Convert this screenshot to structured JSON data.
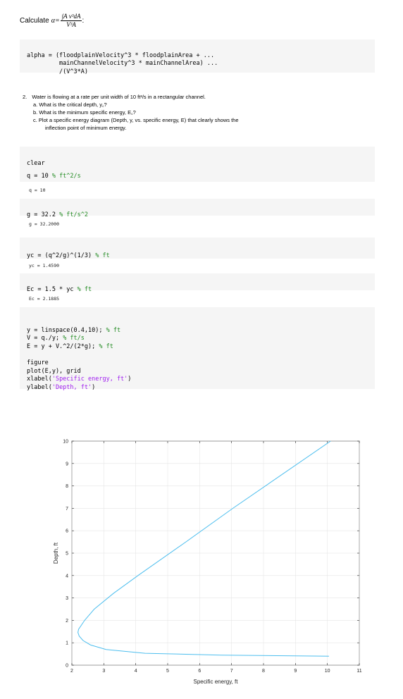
{
  "calculate": {
    "prefix": "Calculate",
    "alpha": "α=",
    "numerator": "∫A v³dA",
    "denominator": "V³A",
    "suffix": ":"
  },
  "code_alpha": [
    "alpha = (floodplainVelocity^3 * floodplainArea + ...",
    "         mainChannelVelocity^3 * mainChannelArea) ...",
    "         /(V^3*A)"
  ],
  "problem": {
    "number": "2.",
    "text": "Water is flowing at a rate per unit width of 10 ft²/s in a rectangular channel.",
    "a": "a.   What is the critical depth, y꜀?",
    "b": "b.   What is the minimum specific energy, E꜀?",
    "c1": "c.   Plot a specific energy diagram (Depth, y, vs. specific energy, E) that clearly shows the",
    "c2": "inflection point of minimum energy."
  },
  "code": {
    "clear": "clear",
    "q_code": "q = 10 ",
    "q_comment": "% ft^2/s",
    "q_out": "q = 10",
    "g_code": "g = 32.2 ",
    "g_comment": "% ft/s^2",
    "g_out": "g = 32.2000",
    "yc_code": "yc = (q^2/g)^(1/3) ",
    "yc_comment": "% ft",
    "yc_out": "yc = 1.4590",
    "ec_code": "Ec = 1.5 * yc ",
    "ec_comment": "% ft",
    "ec_out": "Ec = 2.1885",
    "y_code": "y = linspace(0.4,10); ",
    "y_comment": "% ft",
    "v_code": "V = q./y; ",
    "v_comment": "% ft/s",
    "e_code": "E = y + V.^2/(2*g); ",
    "e_comment": "% ft",
    "figure": "figure",
    "plot": "plot(E,y), grid",
    "xlabel_pre": "xlabel(",
    "xlabel_str": "'Specific energy, ft'",
    "ylabel_pre": "ylabel(",
    "ylabel_str": "'Depth, ft'",
    "close_paren": ")"
  },
  "chart_data": {
    "type": "line",
    "xlabel": "Specific energy, ft",
    "ylabel": "Depth, ft",
    "xlim": [
      2,
      11
    ],
    "ylim": [
      0,
      10
    ],
    "xticks": [
      2,
      3,
      4,
      5,
      6,
      7,
      8,
      9,
      10,
      11
    ],
    "yticks": [
      0,
      1,
      2,
      3,
      4,
      5,
      6,
      7,
      8,
      9,
      10
    ],
    "grid": true,
    "line_color": "#4dbeee",
    "function": "E = y + q^2/(2*g*y^2), q = 10, g = 32.2",
    "series": [
      {
        "x": [
          10.1,
          7.04,
          5.57,
          4.07,
          3.3,
          2.7,
          2.4,
          2.21,
          2.19,
          2.23,
          2.35,
          2.59,
          3.07,
          4.29,
          6.66,
          10.05
        ],
        "y": [
          10,
          7,
          5.5,
          4,
          3.2,
          2.5,
          2.0,
          1.6,
          1.46,
          1.3,
          1.1,
          0.9,
          0.7,
          0.53,
          0.45,
          0.4
        ]
      }
    ]
  }
}
